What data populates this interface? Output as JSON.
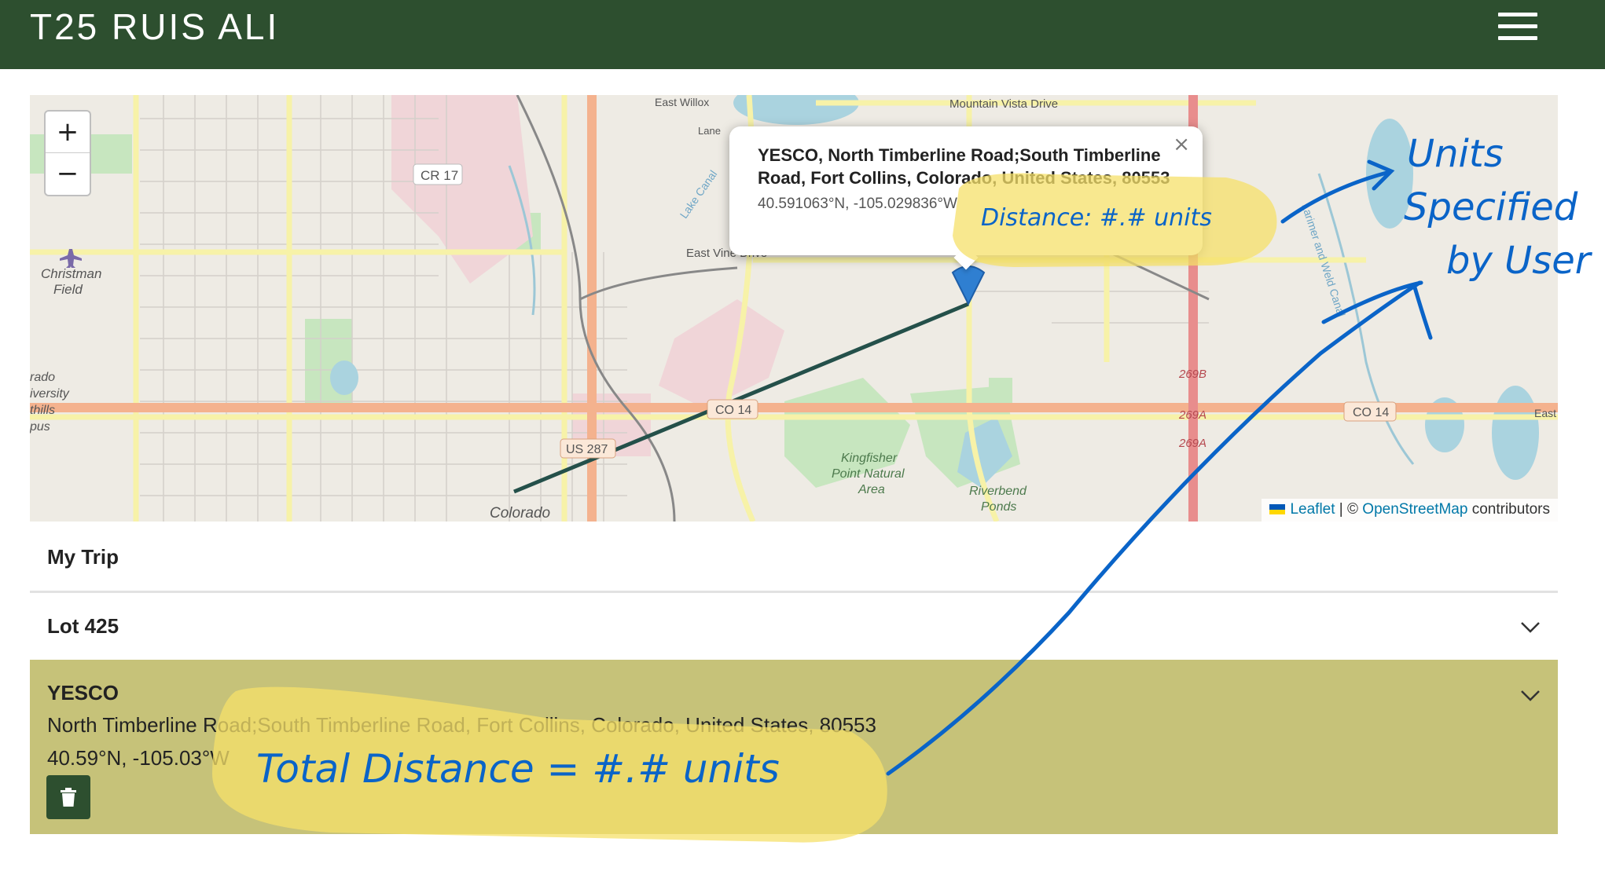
{
  "header": {
    "title": "T25 RUIS ALI",
    "menu_icon": "hamburger-icon"
  },
  "map": {
    "zoom_in_label": "+",
    "zoom_out_label": "−",
    "labels": {
      "mountain_vista": "Mountain Vista Drive",
      "east_willox": "East Willox",
      "lane": "Lane",
      "cr17": "CR 17",
      "lake_canal": "Lake Canal",
      "east_vine": "East Vine Drive",
      "christman": "Christman",
      "field": "Field",
      "co14_mid": "CO 14",
      "co14_right": "CO 14",
      "us287": "US 287",
      "kingfisher1": "Kingfisher",
      "kingfisher2": "Point Natural",
      "kingfisher3": "Area",
      "riverbend1": "Riverbend",
      "riverbend2": "Ponds",
      "colorado": "Colorado",
      "r269b": "269B",
      "r269a1": "269A",
      "r269a2": "269A",
      "east": "East",
      "larimer": "Larimer and Weld Canal",
      "csu1": "rado",
      "csu2": "iversity",
      "csu3": "thills",
      "csu4": "pus"
    },
    "popup": {
      "title": "YESCO, North Timberline Road;South Timberline Road, Fort Collins, Colorado, United States, 80553",
      "coords": "40.591063°N, -105.029836°W",
      "close_label": "×"
    },
    "attribution": {
      "leaflet": "Leaflet",
      "sep": "| ©",
      "osm": "OpenStreetMap",
      "contributors": "contributors"
    }
  },
  "trip": {
    "title": "My Trip",
    "places": [
      {
        "name": "Lot 425"
      },
      {
        "name": "YESCO",
        "address": "North Timberline Road;South Timberline Road, Fort Collins, Colorado, United States, 80553",
        "coords": "40.59°N, -105.03°W"
      }
    ]
  },
  "annotations": {
    "popup_note": "Distance: #.# units",
    "total_note": "Total Distance = #.# units",
    "units_note": [
      "Units",
      "Specified",
      "by User"
    ],
    "highlight_color": "#f5e06a",
    "ink_color": "#0a64c8"
  },
  "colors": {
    "header_bg": "#2d4f2f",
    "selected_row_bg": "#c6c279",
    "route_line": "#24504a",
    "marker": "#2f7fd1"
  }
}
